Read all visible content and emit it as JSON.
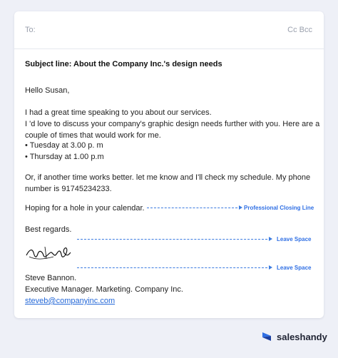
{
  "email": {
    "to_label": "To:",
    "cc_bcc": "Cc Bcc",
    "subject": "Subject line: About the Company Inc.'s design needs",
    "greeting": "Hello Susan,",
    "para1_line1": "I had a great time speaking to you about our services.",
    "para1_line2": "I 'd love to discuss your company's graphic design needs further with you. Here are a",
    "para1_line3": "couple of times that would work for me.",
    "bullet1": "• Tuesday at 3.00 p. m",
    "bullet2": "• Thursday at 1.00 p.m",
    "para2_line1": "Or, if another time works better. let me know and I'll check my schedule. My phone",
    "para2_line2": "number is 91745234233.",
    "closing_line": "Hoping for a hole in your calendar.",
    "signoff": "Best regards.",
    "sender_name": "Steve Bannon.",
    "sender_title": "Executive Manager. Marketing. Company Inc.",
    "sender_email": "steveb@companyinc.com"
  },
  "annotations": {
    "closing": "Professional Closing Line",
    "space1": "Leave Space",
    "space2": "Leave Space"
  },
  "brand": {
    "name": "saleshandy",
    "logo_icon": "saleshandy-logo-icon"
  },
  "colors": {
    "background": "#eef0f7",
    "accent": "#2f6fe4",
    "link": "#2468d8"
  }
}
